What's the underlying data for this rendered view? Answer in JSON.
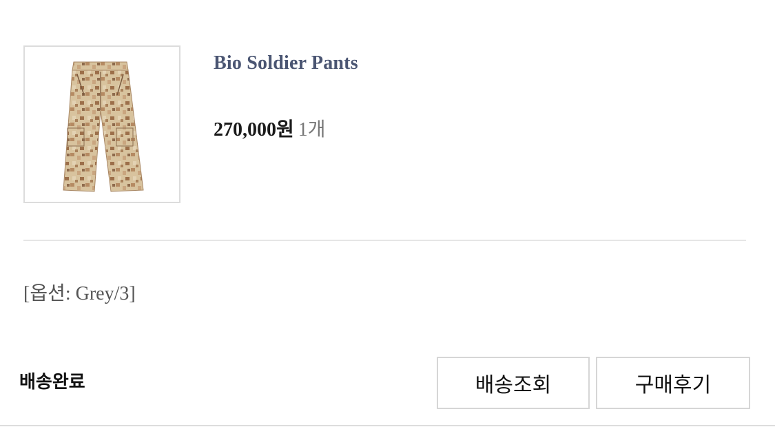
{
  "order_item": {
    "product_name": "Bio Soldier Pants",
    "price": "270,000원",
    "quantity": "1개",
    "option": "[옵션: Grey/3]",
    "status": "배송완료",
    "image_icon": "camo-pants-image"
  },
  "actions": {
    "track_delivery_label": "배송조회",
    "review_label": "구매후기"
  },
  "colors": {
    "product_name": "#4a5572",
    "border": "#d6d6d6",
    "divider": "#e6e6e6"
  }
}
